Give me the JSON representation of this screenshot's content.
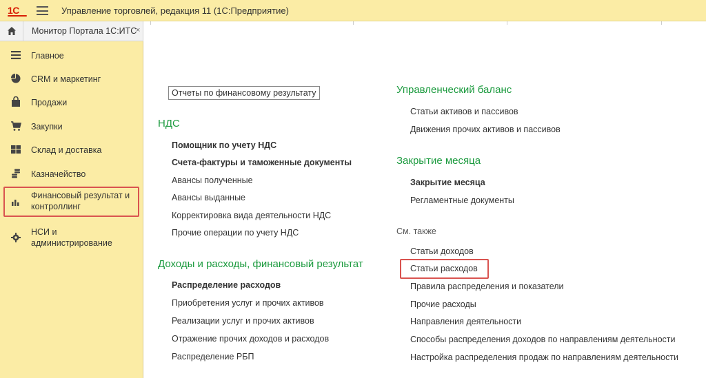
{
  "window": {
    "logo": "1С",
    "title": "Управление торговлей, редакция 11  (1С:Предприятие)"
  },
  "tabs": {
    "home_icon": "home-icon",
    "active_tab": "Монитор Портала 1С:ИТС",
    "close_glyph": "×"
  },
  "sidebar": {
    "items": [
      {
        "label": "Главное",
        "icon": "list-icon"
      },
      {
        "label": "CRM и маркетинг",
        "icon": "pie-chart-icon"
      },
      {
        "label": "Продажи",
        "icon": "bag-icon"
      },
      {
        "label": "Закупки",
        "icon": "cart-icon"
      },
      {
        "label": "Склад и доставка",
        "icon": "grid-icon"
      },
      {
        "label": "Казначейство",
        "icon": "coins-icon"
      },
      {
        "label_line1": "Финансовый результат и",
        "label_line2": "контроллинг",
        "icon": "bar-chart-icon"
      },
      {
        "label_line1": "НСИ и",
        "label_line2": "администрирование",
        "icon": "gear-icon"
      }
    ]
  },
  "content": {
    "top_link": "Отчеты по финансовому результату",
    "vat": {
      "title": "НДС",
      "links": [
        {
          "label": "Помощник по учету НДС",
          "bold": true
        },
        {
          "label": "Счета-фактуры и таможенные документы",
          "bold": true
        },
        {
          "label": "Авансы полученные"
        },
        {
          "label": "Авансы выданные"
        },
        {
          "label": "Корректировка вида деятельности НДС"
        },
        {
          "label": "Прочие операции по учету НДС"
        }
      ]
    },
    "income": {
      "title": "Доходы и расходы, финансовый результат",
      "links": [
        {
          "label": "Распределение расходов",
          "bold": true
        },
        {
          "label": "Приобретения услуг и прочих активов"
        },
        {
          "label": "Реализации услуг и прочих активов"
        },
        {
          "label": "Отражение прочих доходов и расходов"
        },
        {
          "label": "Распределение РБП"
        }
      ]
    },
    "balance": {
      "title": "Управленческий баланс",
      "links": [
        {
          "label": "Статьи активов и пассивов"
        },
        {
          "label": "Движения прочих активов и пассивов"
        }
      ]
    },
    "closing": {
      "title": "Закрытие месяца",
      "links": [
        {
          "label": "Закрытие месяца",
          "bold": true
        },
        {
          "label": "Регламентные документы"
        }
      ]
    },
    "see_also": {
      "title": "См. также",
      "links": [
        {
          "label": "Статьи доходов"
        },
        {
          "label": "Статьи расходов"
        },
        {
          "label": "Правила распределения и показатели"
        },
        {
          "label": "Прочие расходы"
        },
        {
          "label": "Направления деятельности"
        },
        {
          "label": "Способы распределения доходов по направлениям деятельности"
        },
        {
          "label": "Настройка распределения продаж по направлениям деятельности"
        }
      ]
    }
  },
  "colors": {
    "sidebar_bg": "#fbeca5",
    "section_title": "#1b9a3e",
    "highlight": "#d9534f",
    "logo": "#d81e05"
  }
}
